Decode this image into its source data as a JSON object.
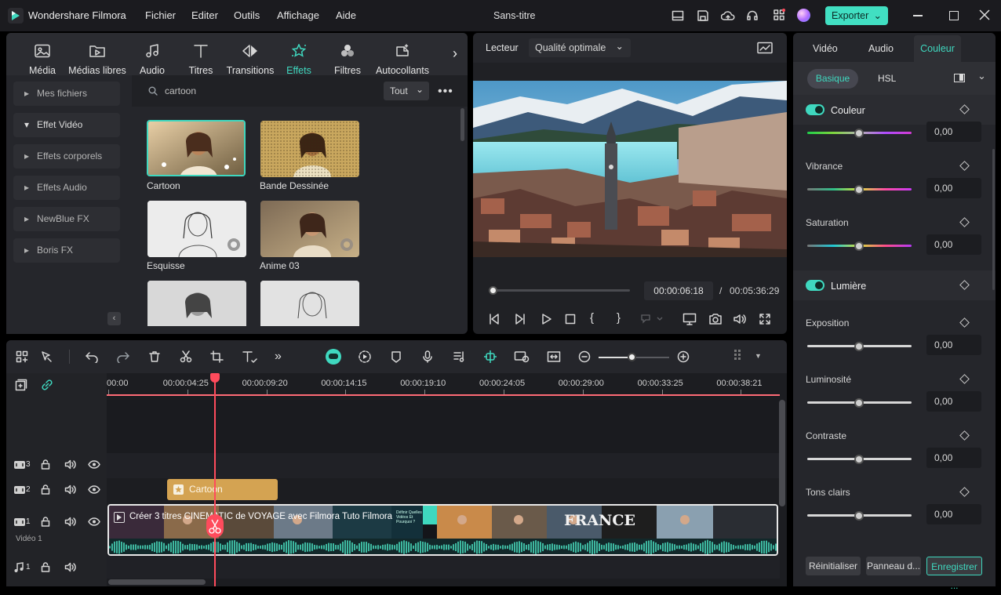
{
  "app": {
    "title": "Wondershare Filmora",
    "doc_title": "Sans-titre",
    "export_label": "Exporter"
  },
  "menu": [
    "Fichier",
    "Editer",
    "Outils",
    "Affichage",
    "Aide"
  ],
  "media_tabs": [
    {
      "label": "Média",
      "icon": "media-icon"
    },
    {
      "label": "Médias libres",
      "icon": "stock-media-icon"
    },
    {
      "label": "Audio",
      "icon": "music-icon"
    },
    {
      "label": "Titres",
      "icon": "text-icon"
    },
    {
      "label": "Transitions",
      "icon": "transition-icon"
    },
    {
      "label": "Effets",
      "icon": "effects-icon"
    },
    {
      "label": "Filtres",
      "icon": "filters-icon"
    },
    {
      "label": "Autocollants",
      "icon": "sticker-icon"
    }
  ],
  "categories": [
    "Mes fichiers",
    "Effet Vidéo",
    "Effets corporels",
    "Effets Audio",
    "NewBlue FX",
    "Boris FX"
  ],
  "search": {
    "value": "cartoon",
    "filter": "Tout"
  },
  "effects": [
    "Cartoon",
    "Bande Dessinée",
    "Esquisse",
    "Anime 03"
  ],
  "player": {
    "label": "Lecteur",
    "quality": "Qualité optimale",
    "current": "00:00:06:18",
    "total": "00:05:36:29",
    "progress": 0.03
  },
  "right_tabs": [
    "Vidéo",
    "Audio",
    "Couleur"
  ],
  "sub_tabs": [
    "Basique",
    "HSL"
  ],
  "sections": {
    "color": "Couleur",
    "light": "Lumière"
  },
  "params": [
    {
      "label": "",
      "value": "0,00"
    },
    {
      "label": "Vibrance",
      "value": "0,00"
    },
    {
      "label": "Saturation",
      "value": "0,00"
    },
    {
      "label": "Exposition",
      "value": "0,00"
    },
    {
      "label": "Luminosité",
      "value": "0,00"
    },
    {
      "label": "Contraste",
      "value": "0,00"
    },
    {
      "label": "Tons clairs",
      "value": "0,00"
    }
  ],
  "bottom_buttons": [
    "Réinitialiser",
    "Panneau d...",
    "Enregistrer ..."
  ],
  "ruler": [
    "00:00",
    "00:00:04:25",
    "00:00:09:20",
    "00:00:14:15",
    "00:00:19:10",
    "00:00:24:05",
    "00:00:29:00",
    "00:00:33:25",
    "00:00:38:21"
  ],
  "timeline": {
    "effect_clip": "Cartoon",
    "video_clip": "Créer 3 titres CINEMATIC de VOYAGE avec Filmora  Tuto Filmora",
    "video_track_label": "Vidéo 1",
    "tracks": [
      "3",
      "2",
      "1",
      "1"
    ],
    "frame_text": "FRANCE",
    "small_text": "Définir Quelles Vidéos Et Pourquoi ?"
  },
  "colors": {
    "accent": "#3fd8bf",
    "export_bg": "#41dfc2",
    "playhead": "#ff4b5c",
    "effect_clip": "#d4a352",
    "audio_wave": "#3eb8a0"
  }
}
